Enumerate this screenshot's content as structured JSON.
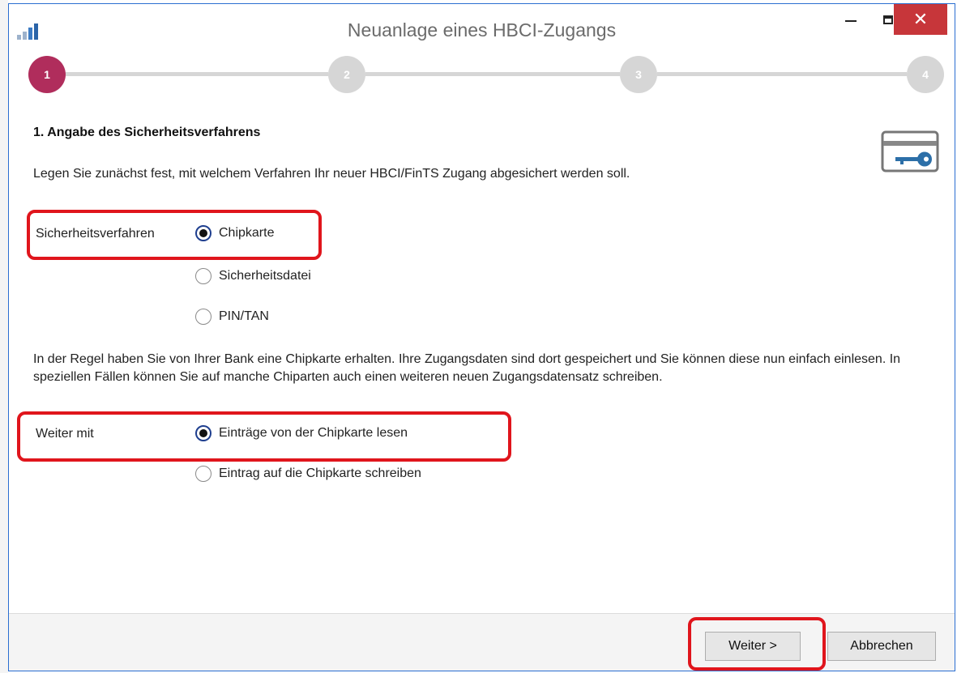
{
  "window": {
    "title": "Neuanlage eines HBCI-Zugangs",
    "close_glyph": "✕"
  },
  "stepper": {
    "steps": [
      "1",
      "2",
      "3",
      "4"
    ],
    "active_step": 1,
    "active_color": "#b02d5c",
    "inactive_color": "#d6d6d6"
  },
  "content": {
    "heading": "1. Angabe des Sicherheitsverfahrens",
    "intro": "Legen Sie zunächst fest, mit welchem Verfahren Ihr neuer HBCI/FinTS Zugang abgesichert werden soll.",
    "security": {
      "label": "Sicherheitsverfahren",
      "options": [
        "Chipkarte",
        "Sicherheitsdatei",
        "PIN/TAN"
      ],
      "selected": "Chipkarte"
    },
    "info_text": "In der Regel haben Sie von Ihrer Bank eine Chipkarte erhalten. Ihre Zugangsdaten sind dort gespeichert und Sie können diese nun einfach einlesen. In speziellen Fällen können Sie auf manche Chiparten auch einen weiteren neuen Zugangsdatensatz schreiben.",
    "continue": {
      "label": "Weiter mit",
      "options": [
        "Einträge von der Chipkarte lesen",
        "Eintrag auf die Chipkarte schreiben"
      ],
      "selected": "Einträge von der Chipkarte lesen"
    }
  },
  "footer": {
    "next_label": "Weiter >",
    "cancel_label": "Abbrechen"
  },
  "colors": {
    "window_border": "#2a6ed1",
    "close_button": "#c7363a",
    "highlight": "#e0151c",
    "card_icon": "#2c6fa8"
  }
}
